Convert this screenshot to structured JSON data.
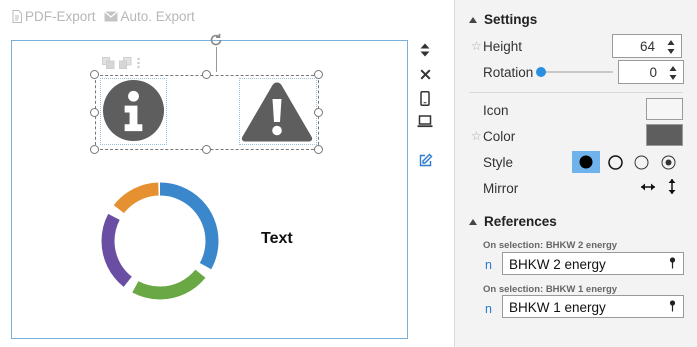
{
  "toolbar": {
    "pdf_export_label": "PDF-Export",
    "auto_export_label": "Auto. Export"
  },
  "canvas": {
    "text_element": "Text",
    "donut_segments": [
      {
        "color": "#3a87cb",
        "fraction": 0.33
      },
      {
        "color": "#6aa846",
        "fraction": 0.22
      },
      {
        "color": "#6a4ea3",
        "fraction": 0.22
      },
      {
        "color": "#e69131",
        "fraction": 0.14
      }
    ]
  },
  "settings": {
    "section_title": "Settings",
    "height_label": "Height",
    "height_value": "64",
    "rotation_label": "Rotation",
    "rotation_value": "0",
    "icon_label": "Icon",
    "color_label": "Color",
    "color_value": "#5e5e5e",
    "style_label": "Style",
    "mirror_label": "Mirror"
  },
  "references": {
    "section_title": "References",
    "items": [
      {
        "caption": "On selection: BHKW 2 energy",
        "prefix": "n",
        "value": "BHKW 2 energy"
      },
      {
        "caption": "On selection: BHKW 1 energy",
        "prefix": "n",
        "value": "BHKW 1 energy"
      }
    ]
  },
  "colors": {
    "accent": "#2b8fe0",
    "selection_border": "#79b0db",
    "icon_fill": "#5e5e5e"
  }
}
